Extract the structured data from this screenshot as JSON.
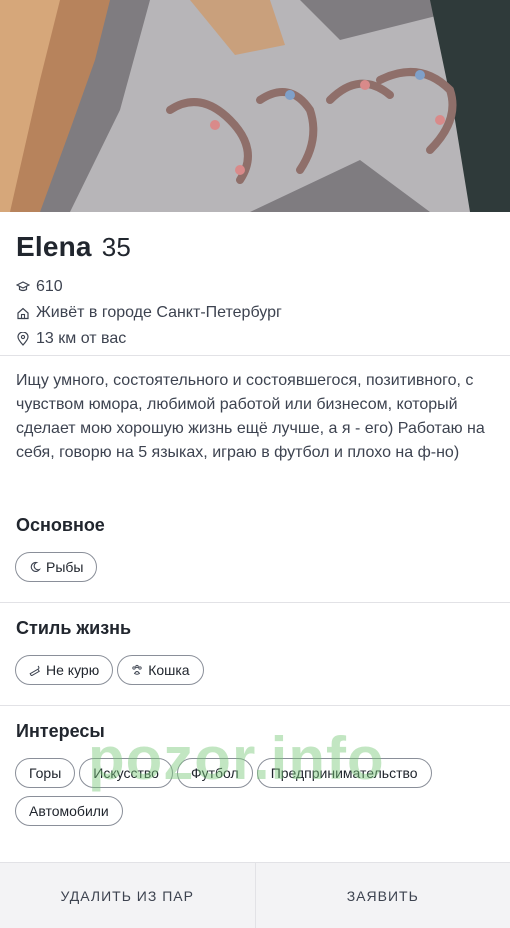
{
  "profile": {
    "name": "Elena",
    "age": "35",
    "score": "610",
    "city": "Живёт в городе Санкт-Петербург",
    "distance": "13 км от вас",
    "bio": "Ищу умного, состоятельного и состоявшегося, позитивного, с чувством юмора, любимой работой или бизнесом, который сделает мою хорошую жизнь ещё лучше, а я - его) Работаю на себя, говорю на 5 языках, играю в футбол и плохо на ф-но)"
  },
  "sections": {
    "basic": {
      "title": "Основное",
      "chips": [
        {
          "label": "Рыбы",
          "icon": "zodiac-pisces-icon"
        }
      ]
    },
    "lifestyle": {
      "title": "Стиль жизнь",
      "chips": [
        {
          "label": "Не курю",
          "icon": "no-smoking-icon"
        },
        {
          "label": "Кошка",
          "icon": "paw-icon"
        }
      ]
    },
    "interests": {
      "title": "Интересы",
      "chips": [
        "Горы",
        "Искусство",
        "Футбол",
        "Предпринимательство",
        "Автомобили"
      ]
    }
  },
  "watermark": "pozor.info",
  "actions": {
    "remove_label": "УДАЛИТЬ ИЗ ПАР",
    "report_label": "ЗАЯВИТЬ"
  },
  "icons": {
    "score": "graduation-cap-icon",
    "city": "home-icon",
    "distance": "location-pin-icon"
  },
  "colors": {
    "text": "#21262e",
    "muted": "#3d4350",
    "divider": "#e2e2e6",
    "bar": "#f3f3f5"
  }
}
